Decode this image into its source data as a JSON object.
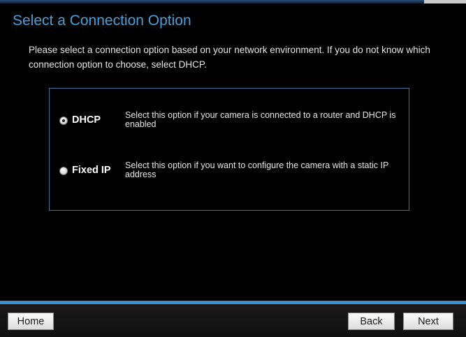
{
  "page": {
    "title": "Select a Connection Option",
    "intro": "Please select a connection option based on your network environment. If you do not know which connection option to choose, select DHCP."
  },
  "options": [
    {
      "label": "DHCP",
      "description": "Select this option if your camera is connected to a router and DHCP is enabled",
      "selected": true
    },
    {
      "label": "Fixed IP",
      "description": "Select this option if you want to configure the camera with a static IP address",
      "selected": false
    }
  ],
  "footer": {
    "home_label": "Home",
    "back_label": "Back",
    "next_label": "Next"
  },
  "colors": {
    "title": "#4a9fd8",
    "accent_line": "#3d8fd0",
    "box_border": "#3c6f99",
    "background": "#000000"
  }
}
